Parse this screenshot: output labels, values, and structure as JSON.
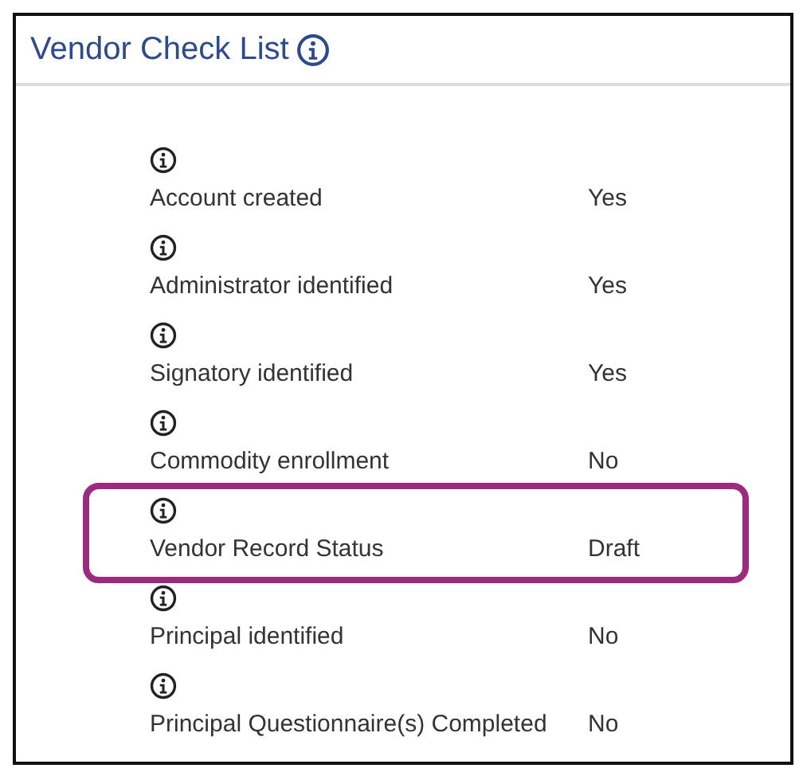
{
  "panel": {
    "title": "Vendor Check List"
  },
  "checks": [
    {
      "label": "Account created",
      "value": "Yes",
      "highlighted": false
    },
    {
      "label": "Administrator identified",
      "value": "Yes",
      "highlighted": false
    },
    {
      "label": "Signatory identified",
      "value": "Yes",
      "highlighted": false
    },
    {
      "label": "Commodity enrollment",
      "value": "No",
      "highlighted": false
    },
    {
      "label": "Vendor Record Status",
      "value": "Draft",
      "highlighted": true
    },
    {
      "label": "Principal identified",
      "value": "No",
      "highlighted": false
    },
    {
      "label": "Principal Questionnaire(s) Completed",
      "value": "No",
      "highlighted": false
    }
  ]
}
